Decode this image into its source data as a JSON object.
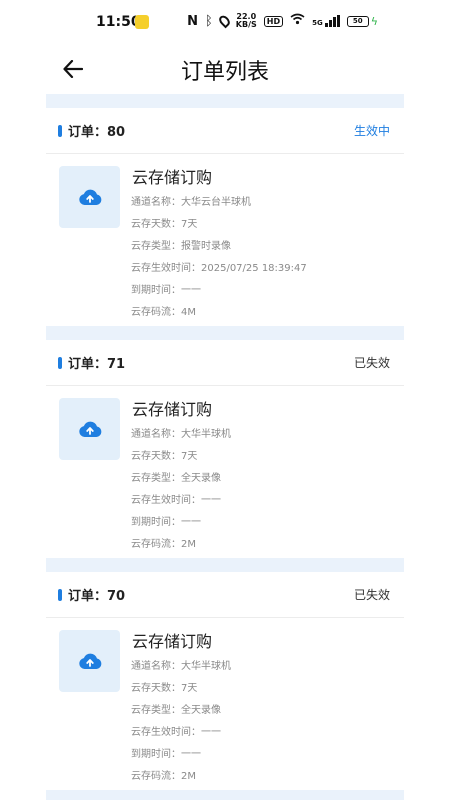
{
  "status_bar": {
    "time": "11:50",
    "speed_top": "22.0",
    "speed_unit": "KB/S",
    "hd": "HD",
    "net": "5G",
    "battery": "50"
  },
  "header": {
    "title": "订单列表"
  },
  "colors": {
    "accent": "#1f7ee0",
    "active_status": "#1f7ee0",
    "expired_status": "#333333",
    "divider_band": "#eaf2fb",
    "thumb_bg": "#e3effa"
  },
  "orders": [
    {
      "id_label": "订单：80",
      "status": "生效中",
      "product": "云存储订购",
      "details": [
        "通道名称：大华云台半球机",
        "云存天数：7天",
        "云存类型：报警时录像",
        "云存生效时间：2025/07/25 18:39:47",
        "到期时间：一一",
        "云存码流：4M"
      ]
    },
    {
      "id_label": "订单：71",
      "status": "已失效",
      "product": "云存储订购",
      "details": [
        "通道名称：大华半球机",
        "云存天数：7天",
        "云存类型：全天录像",
        "云存生效时间：一一",
        "到期时间：一一",
        "云存码流：2M"
      ]
    },
    {
      "id_label": "订单：70",
      "status": "已失效",
      "product": "云存储订购",
      "details": [
        "通道名称：大华半球机",
        "云存天数：7天",
        "云存类型：全天录像",
        "云存生效时间：一一",
        "到期时间：一一",
        "云存码流：2M"
      ]
    }
  ]
}
